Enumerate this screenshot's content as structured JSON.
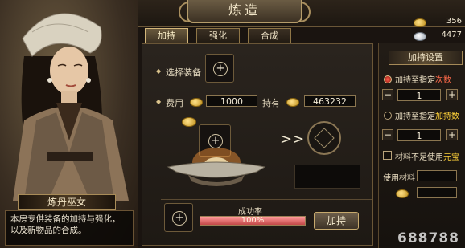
{
  "header": {
    "title": "炼造"
  },
  "tabs": [
    {
      "label": "加持",
      "active": true
    },
    {
      "label": "强化",
      "active": false
    },
    {
      "label": "合成",
      "active": false
    }
  ],
  "currency": {
    "gold": "356",
    "silver": "4477"
  },
  "npc": {
    "name": "炼丹巫女",
    "description": "本房专供装备的加持与强化，以及新物品的合成。"
  },
  "main": {
    "select_label": "选择装备",
    "fee_label": "费用",
    "fee_value": "1000",
    "own_label": "持有",
    "own_value": "463232",
    "success_label": "成功率",
    "success_rate_text": "100%",
    "success_rate": 1.0,
    "enhance_button": "加持",
    "plus": "+"
  },
  "settings": {
    "title": "加持设置",
    "option1_prefix": "加持至指定",
    "option1_suffix": "次数",
    "option1_value": "1",
    "option2_prefix": "加持至指定",
    "option2_suffix": "加持数",
    "option2_value": "1",
    "use_yuanbao_prefix": "材料不足使用",
    "use_yuanbao_suffix": "元宝",
    "use_material_label": "使用材料"
  },
  "watermark": "688788",
  "colors": {
    "accent": "#c6a96d",
    "highlight_red": "#ff6a4a",
    "highlight_yellow": "#ffd23a",
    "progress": "#c24848"
  }
}
